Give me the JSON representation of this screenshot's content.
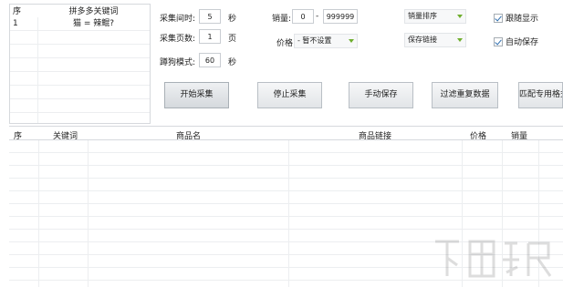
{
  "keyword_panel": {
    "col_index": "序",
    "col_keywords": "拼多多关键词",
    "rows": [
      {
        "index": "1",
        "keyword": "猫 = 辣鲲?"
      }
    ]
  },
  "settings": {
    "interval_label": "采集间时:",
    "interval_value": "5",
    "interval_unit": "秒",
    "pages_label": "采集页数:",
    "pages_value": "1",
    "pages_unit": "页",
    "guard_label": "蹲狗模式:",
    "guard_value": "60",
    "guard_unit": "秒",
    "sales_label": "销量:",
    "sales_min": "0",
    "sales_sep": "-",
    "sales_max": "999999",
    "price_label": "价格:",
    "price_value": "- 暂不设置",
    "sort_value": "销量排序",
    "save_value": "保存链接"
  },
  "checks": {
    "follow_display": "跟随显示",
    "auto_save": "自动保存"
  },
  "buttons": {
    "start": "开始采集",
    "stop": "停止采集",
    "manual_save": "手动保存",
    "filter_dup": "过滤重复数据",
    "match": "匹配专用格式"
  },
  "results": {
    "col_index": "序",
    "col_keyword": "关键词",
    "col_name": "商品名",
    "col_link": "商品链接",
    "col_price": "价格",
    "col_sales": "销量"
  },
  "colors": {
    "accent_green": "#6fae2e",
    "grid_line": "#eceef0",
    "border": "#d6d9dd"
  }
}
